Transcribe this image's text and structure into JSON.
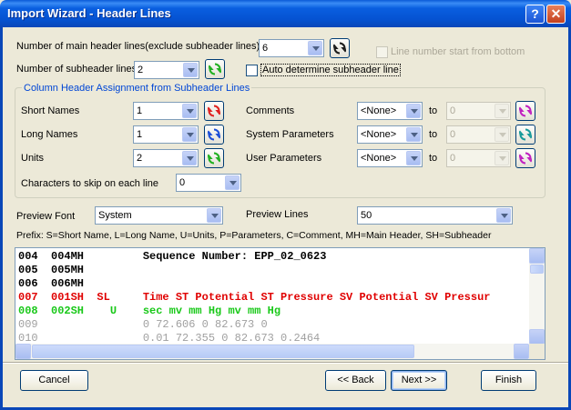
{
  "window": {
    "title": "Import Wizard - Header Lines",
    "help_label": "?",
    "close_label": "✕"
  },
  "header": {
    "main_lines_label": "Number of main header lines(exclude subheader lines)",
    "main_lines_value": "6",
    "line_number_bottom_label": "Line number start from bottom",
    "sub_lines_label": "Number of subheader lines",
    "sub_lines_value": "2",
    "auto_determine_label": "Auto determine subheader line"
  },
  "assignment": {
    "group_title": "Column Header Assignment from Subheader Lines",
    "short_names_label": "Short Names",
    "short_names_value": "1",
    "long_names_label": "Long Names",
    "long_names_value": "1",
    "units_label": "Units",
    "units_value": "2",
    "comments_label": "Comments",
    "comments_value": "<None>",
    "comments_to_label": "to",
    "comments_to_value": "0",
    "system_params_label": "System Parameters",
    "system_params_value": "<None>",
    "system_to_label": "to",
    "system_to_value": "0",
    "user_params_label": "User Parameters",
    "user_params_value": "<None>",
    "user_to_label": "to",
    "user_to_value": "0",
    "skip_label": "Characters to skip on each line",
    "skip_value": "0"
  },
  "preview_settings": {
    "font_label": "Preview Font",
    "font_value": "System",
    "lines_label": "Preview Lines",
    "lines_value": "50",
    "prefix_text": "Prefix:  S=Short Name, L=Long Name, U=Units, P=Parameters, C=Comment, MH=Main Header, SH=Subheader"
  },
  "preview_lines": [
    {
      "text": "004  004MH         Sequence Number: EPP_02_0623",
      "color": "black"
    },
    {
      "text": "005  005MH",
      "color": "black"
    },
    {
      "text": "006  006MH",
      "color": "black"
    },
    {
      "text": "007  001SH  SL     Time ST Potential ST Pressure SV Potential SV Pressur",
      "color": "red"
    },
    {
      "text": "008  002SH    U    sec mv mm Hg mv mm Hg",
      "color": "green"
    },
    {
      "text": "009                0 72.606 0 82.673 0",
      "color": "gray"
    },
    {
      "text": "010                0.01 72.355 0 82.673 0.2464",
      "color": "gray"
    }
  ],
  "buttons": {
    "cancel": "Cancel",
    "back": "<< Back",
    "next": "Next >>",
    "finish": "Finish"
  },
  "colors": {
    "refresh_black": "#1a1a1a",
    "refresh_red": "#e02020",
    "refresh_blue": "#1c4fd8",
    "refresh_green": "#20b020",
    "refresh_magenta": "#c020c0",
    "refresh_teal": "#189a9a"
  }
}
